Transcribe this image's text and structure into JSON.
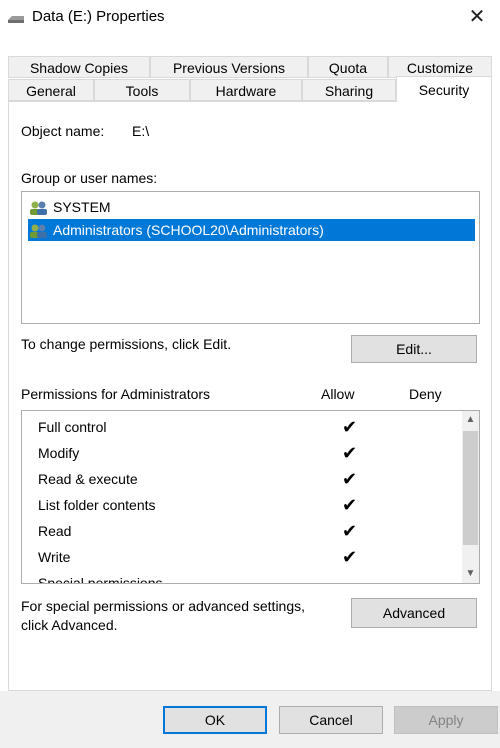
{
  "window": {
    "title": "Data (E:) Properties",
    "close_icon": "close-icon",
    "drive_icon": "drive-icon"
  },
  "tabs": {
    "row1": [
      "Shadow Copies",
      "Previous Versions",
      "Quota",
      "Customize"
    ],
    "row2": [
      "General",
      "Tools",
      "Hardware",
      "Sharing",
      "Security"
    ],
    "active": "Security"
  },
  "security": {
    "object_name_label": "Object name:",
    "object_name_value": "E:\\",
    "groups_label": "Group or user names:",
    "groups": [
      {
        "name": "SYSTEM",
        "selected": false
      },
      {
        "name": "Administrators (SCHOOL20\\Administrators)",
        "selected": true
      }
    ],
    "change_text": "To change permissions, click Edit.",
    "edit_button": "Edit...",
    "permissions_label": "Permissions for Administrators",
    "allow_header": "Allow",
    "deny_header": "Deny",
    "permissions": [
      {
        "name": "Full control",
        "allow": "✔",
        "deny": ""
      },
      {
        "name": "Modify",
        "allow": "✔",
        "deny": ""
      },
      {
        "name": "Read & execute",
        "allow": "✔",
        "deny": ""
      },
      {
        "name": "List folder contents",
        "allow": "✔",
        "deny": ""
      },
      {
        "name": "Read",
        "allow": "✔",
        "deny": ""
      },
      {
        "name": "Write",
        "allow": "✔",
        "deny": ""
      },
      {
        "name": "Special permissions",
        "allow": "",
        "deny": ""
      }
    ],
    "advanced_text_line1": "For special permissions or advanced settings,",
    "advanced_text_line2": "click Advanced.",
    "advanced_button": "Advanced"
  },
  "footer": {
    "ok": "OK",
    "cancel": "Cancel",
    "apply": "Apply"
  },
  "colors": {
    "selection": "#0078d7",
    "button_face": "#e1e1e1",
    "dialog_bg": "#f0f0f0"
  }
}
